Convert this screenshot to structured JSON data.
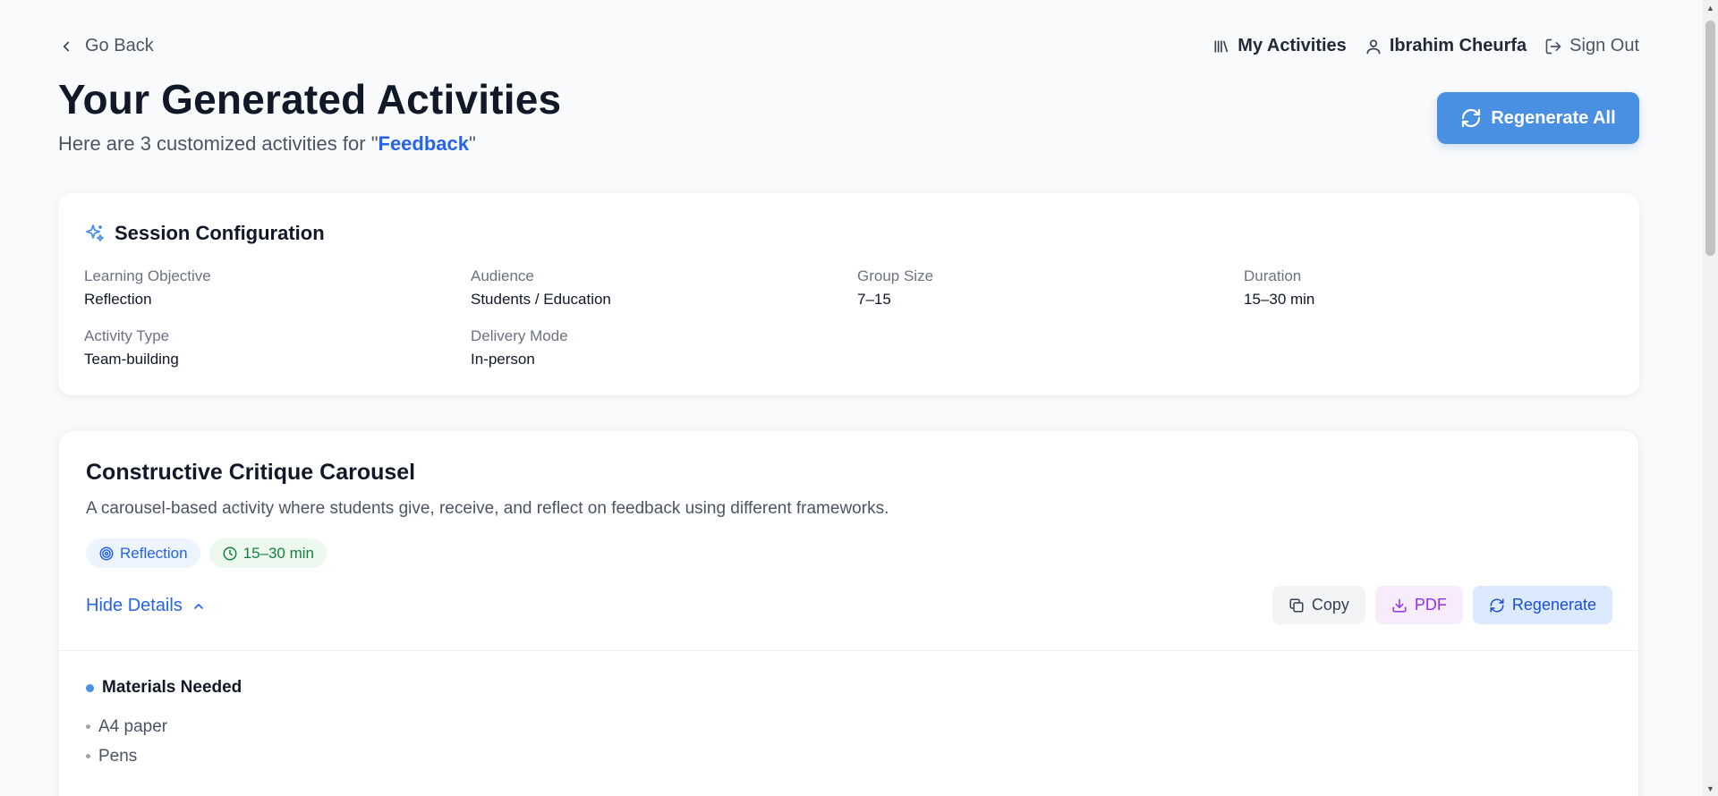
{
  "nav": {
    "back_label": "Go Back",
    "my_activities": "My Activities",
    "user_name": "Ibrahim Cheurfa",
    "sign_out": "Sign Out"
  },
  "header": {
    "title": "Your Generated Activities",
    "subtitle_prefix": "Here are 3 customized activities for \"",
    "topic": "Feedback",
    "subtitle_suffix": "\"",
    "regenerate_all": "Regenerate All"
  },
  "config": {
    "heading": "Session Configuration",
    "fields": [
      {
        "label": "Learning Objective",
        "value": "Reflection"
      },
      {
        "label": "Audience",
        "value": "Students / Education"
      },
      {
        "label": "Group Size",
        "value": "7–15"
      },
      {
        "label": "Duration",
        "value": "15–30 min"
      },
      {
        "label": "Activity Type",
        "value": "Team-building"
      },
      {
        "label": "Delivery Mode",
        "value": "In-person"
      }
    ]
  },
  "activity": {
    "title": "Constructive Critique Carousel",
    "description": "A carousel-based activity where students give, receive, and reflect on feedback using different frameworks.",
    "tags": [
      "Reflection",
      "15–30 min"
    ],
    "hide_details": "Hide Details",
    "actions": {
      "copy": "Copy",
      "pdf": "PDF",
      "regenerate": "Regenerate"
    },
    "materials_heading": "Materials Needed",
    "materials": [
      "A4 paper",
      "Pens"
    ]
  },
  "colors": {
    "accent": "#4a90e2",
    "link": "#2563eb",
    "pdf": "#9333ea",
    "time_tag": "#15803d"
  },
  "icons": {
    "back": "chevron-left-icon",
    "library": "library-icon",
    "user": "user-icon",
    "sign_out": "log-out-icon",
    "refresh": "refresh-icon",
    "sparkles": "sparkles-icon",
    "target": "target-icon",
    "clock": "clock-icon",
    "chevron_up": "chevron-up-icon",
    "copy": "copy-icon",
    "download": "download-icon"
  }
}
